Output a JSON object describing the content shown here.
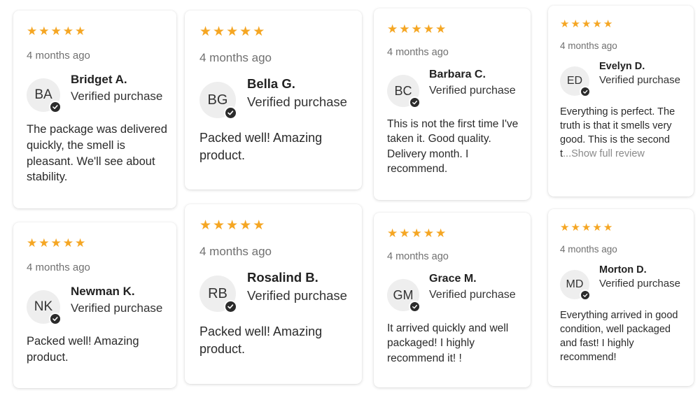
{
  "colors": {
    "star": "#f5a623",
    "check_badge": "#2b2b2b",
    "avatar_bg": "#eeeeee"
  },
  "reviews": [
    {
      "rating": 5,
      "date": "4 months ago",
      "initials": "BA",
      "name": "Bridget A.",
      "verified": "Verified purchase",
      "text": "The package was delivered quickly, the smell is pleasant. We'll see about stability."
    },
    {
      "rating": 5,
      "date": "4 months ago",
      "initials": "BG",
      "name": "Bella G.",
      "verified": "Verified purchase",
      "text": "Packed well! Amazing product."
    },
    {
      "rating": 5,
      "date": "4 months ago",
      "initials": "BC",
      "name": "Barbara C.",
      "verified": "Verified purchase",
      "text": "This is not the first time I've taken it. Good quality. Delivery month. I recommend."
    },
    {
      "rating": 5,
      "date": "4 months ago",
      "initials": "ED",
      "name": "Evelyn D.",
      "verified": "Verified purchase",
      "text": "Everything is perfect. The truth is that it smells very good. This is the second t",
      "more": "...Show full review"
    },
    {
      "rating": 5,
      "date": "4 months ago",
      "initials": "NK",
      "name": "Newman K.",
      "verified": "Verified purchase",
      "text": "Packed well! Amazing product."
    },
    {
      "rating": 5,
      "date": "4 months ago",
      "initials": "RB",
      "name": "Rosalind B.",
      "verified": "Verified purchase",
      "text": "Packed well! Amazing product."
    },
    {
      "rating": 5,
      "date": "4 months ago",
      "initials": "GM",
      "name": "Grace M.",
      "verified": "Verified purchase",
      "text": "It arrived quickly and well packaged! I highly recommend it! !"
    },
    {
      "rating": 5,
      "date": "4 months ago",
      "initials": "MD",
      "name": "Morton D.",
      "verified": "Verified purchase",
      "text": "Everything arrived in good condition, well packaged and fast! I highly recommend!"
    }
  ]
}
